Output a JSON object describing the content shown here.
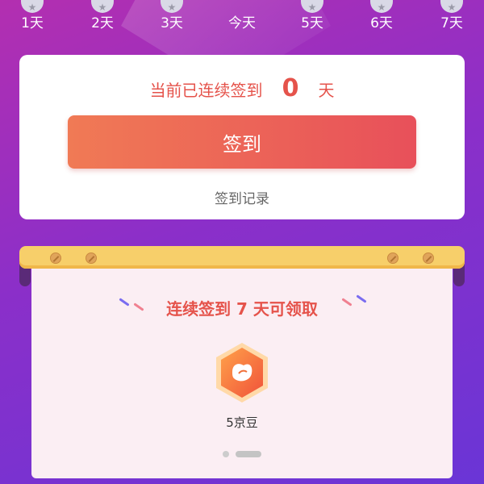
{
  "days": [
    {
      "label": "1天"
    },
    {
      "label": "2天"
    },
    {
      "label": "3天"
    },
    {
      "label": "今天"
    },
    {
      "label": "5天"
    },
    {
      "label": "6天"
    },
    {
      "label": "7天"
    }
  ],
  "card": {
    "streak_prefix": "当前已连续签到",
    "streak_count": "0",
    "streak_suffix": "天",
    "signin_label": "签到",
    "record_label": "签到记录"
  },
  "reward": {
    "title": "连续签到 7 天可领取",
    "item_label": "5京豆",
    "item_icon": "bean-icon",
    "page_count": 2,
    "active_page": 2
  },
  "colors": {
    "accent": "#e5534b",
    "button_start": "#f07a55",
    "button_end": "#e8505a",
    "bg_top": "#b32fb0",
    "bg_bottom": "#6a35d6"
  }
}
